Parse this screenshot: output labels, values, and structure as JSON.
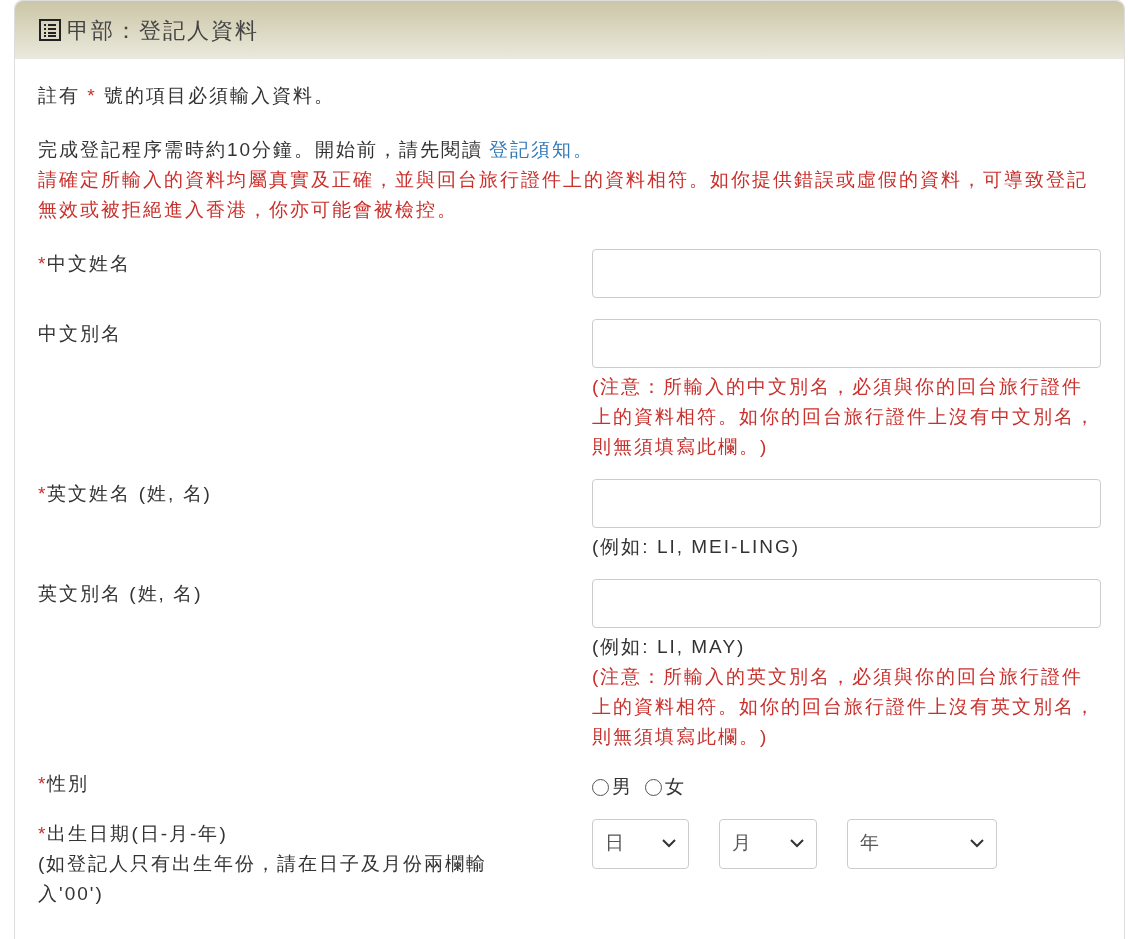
{
  "section": {
    "title": "甲部：登記人資料"
  },
  "required_note": {
    "before": "註有",
    "mark": "*",
    "after": "號的項目必須輸入資料。"
  },
  "intro": {
    "text": "完成登記程序需時約10分鐘。開始前，請先閱讀",
    "link": "登記須知",
    "after": "。"
  },
  "warning": "請確定所輸入的資料均屬真實及正確，並與回台旅行證件上的資料相符。如你提供錯誤或虛假的資料，可導致登記無效或被拒絕進入香港，你亦可能會被檢控。",
  "fields": [
    {
      "kind": "text",
      "label": "中文姓名",
      "required": true
    },
    {
      "kind": "text",
      "label": "中文別名",
      "required": false,
      "hints": [
        {
          "kind": "warning",
          "text": "(注意：所輸入的中文別名，必須與你的回台旅行證件上的資料相符。如你的回台旅行證件上沒有中文別名，則無須填寫此欄。)"
        }
      ]
    },
    {
      "kind": "text",
      "label": "英文姓名 (姓, 名)",
      "required": true,
      "hints": [
        {
          "kind": "example",
          "text": "(例如: LI, MEI-LING)"
        }
      ]
    },
    {
      "kind": "text",
      "label": "英文別名 (姓, 名)",
      "required": false,
      "hints": [
        {
          "kind": "example",
          "text": "(例如: LI, MAY)"
        },
        {
          "kind": "warning",
          "text": "(注意：所輸入的英文別名，必須與你的回台旅行證件上的資料相符。如你的回台旅行證件上沒有英文別名，則無須填寫此欄。)"
        }
      ]
    },
    {
      "kind": "radio",
      "label": "性別",
      "required": true,
      "options": [
        {
          "label": "男",
          "selected": false
        },
        {
          "label": "女",
          "selected": false
        }
      ]
    },
    {
      "kind": "date",
      "label": "出生日期(日-月-年)",
      "required": true,
      "note": "(如登記人只有出生年份，請在日子及月份兩欄輸入'00')",
      "selects": [
        {
          "placeholder": "日"
        },
        {
          "placeholder": "月"
        },
        {
          "placeholder": "年"
        }
      ]
    }
  ]
}
